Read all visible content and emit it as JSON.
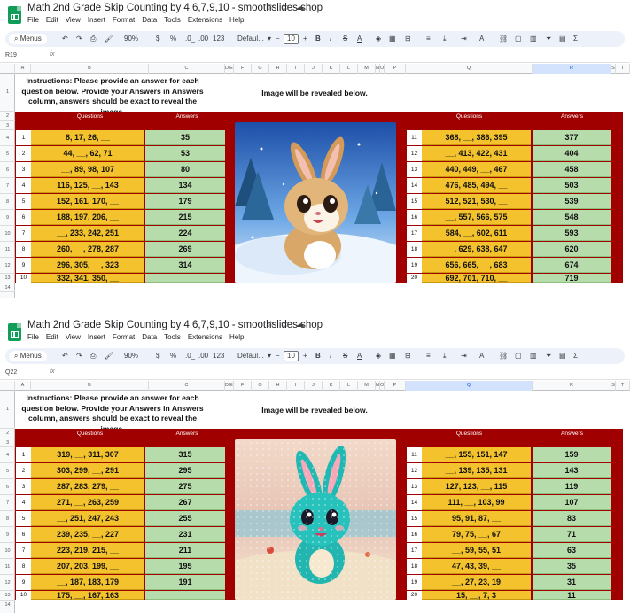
{
  "screenshots": [
    {
      "title": "Math 2nd Grade Skip Counting by 4,6,7,9,10 - smoothslides shop",
      "menu": [
        "File",
        "Edit",
        "View",
        "Insert",
        "Format",
        "Data",
        "Tools",
        "Extensions",
        "Help"
      ],
      "toolbar": {
        "menus": "Menus",
        "zoom": "90%",
        "currency": "$",
        "percent": "%",
        "dec_down": ".0_",
        "dec_up": ".00",
        "format_123": "123",
        "font": "Defaul...",
        "font_size": "10"
      },
      "cell_ref": "R19",
      "fx": "fx",
      "selected_col": "R",
      "instructions": "Instructions: Please provide an answer for each question below. Provide your Answers in Answers column, answers should be exact to reveal the image.",
      "reveal_text": "Image will be revealed below.",
      "header_questions": "Questions",
      "header_answers": "Answers",
      "image_description": "cartoon bunny in snowy winter scene",
      "left": [
        {
          "n": "1",
          "q": "8, 17, 26, __",
          "a": "35"
        },
        {
          "n": "2",
          "q": "44, __, 62, 71",
          "a": "53"
        },
        {
          "n": "3",
          "q": "__, 89, 98, 107",
          "a": "80"
        },
        {
          "n": "4",
          "q": "116, 125, __, 143",
          "a": "134"
        },
        {
          "n": "5",
          "q": "152, 161, 170, __",
          "a": "179"
        },
        {
          "n": "6",
          "q": "188, 197, 206, __",
          "a": "215"
        },
        {
          "n": "7",
          "q": "__, 233, 242, 251",
          "a": "224"
        },
        {
          "n": "8",
          "q": "260, __, 278, 287",
          "a": "269"
        },
        {
          "n": "9",
          "q": "296, 305, __, 323",
          "a": "314"
        },
        {
          "n": "10",
          "q": "332, 341, 350, __",
          "a": ""
        }
      ],
      "right": [
        {
          "n": "11",
          "q": "368, __, 386, 395",
          "a": "377"
        },
        {
          "n": "12",
          "q": "__, 413, 422, 431",
          "a": "404"
        },
        {
          "n": "13",
          "q": "440, 449, __, 467",
          "a": "458"
        },
        {
          "n": "14",
          "q": "476, 485, 494, __",
          "a": "503"
        },
        {
          "n": "15",
          "q": "512, 521, 530, __",
          "a": "539"
        },
        {
          "n": "16",
          "q": "__, 557, 566, 575",
          "a": "548"
        },
        {
          "n": "17",
          "q": "584, __, 602, 611",
          "a": "593"
        },
        {
          "n": "18",
          "q": "__, 629, 638, 647",
          "a": "620"
        },
        {
          "n": "19",
          "q": "656, 665, __, 683",
          "a": "674"
        },
        {
          "n": "20",
          "q": "692, 701, 710, __",
          "a": "719"
        }
      ]
    },
    {
      "title": "Math 2nd Grade Skip Counting by 4,6,7,9,10 - smoothslides shop",
      "menu": [
        "File",
        "Edit",
        "View",
        "Insert",
        "Format",
        "Data",
        "Tools",
        "Extensions",
        "Help"
      ],
      "toolbar": {
        "menus": "Menus",
        "zoom": "90%",
        "currency": "$",
        "percent": "%",
        "dec_down": ".0_",
        "dec_up": ".00",
        "format_123": "123",
        "font": "Defaul...",
        "font_size": "10"
      },
      "cell_ref": "Q22",
      "fx": "fx",
      "selected_col": "Q",
      "instructions": "Instructions: Please provide an answer for each question below. Provide your Answers in Answers column, answers should be exact to reveal the image.",
      "reveal_text": "Image will be revealed below.",
      "header_questions": "Questions",
      "header_answers": "Answers",
      "image_description": "teal cartoon bunny on beach, partially revealed",
      "left": [
        {
          "n": "1",
          "q": "319, __, 311, 307",
          "a": "315"
        },
        {
          "n": "2",
          "q": "303, 299, __, 291",
          "a": "295"
        },
        {
          "n": "3",
          "q": "287, 283, 279, __",
          "a": "275"
        },
        {
          "n": "4",
          "q": "271, __, 263, 259",
          "a": "267"
        },
        {
          "n": "5",
          "q": "__, 251, 247, 243",
          "a": "255"
        },
        {
          "n": "6",
          "q": "239, 235, __, 227",
          "a": "231"
        },
        {
          "n": "7",
          "q": "223, 219, 215, __",
          "a": "211"
        },
        {
          "n": "8",
          "q": "207, 203, 199, __",
          "a": "195"
        },
        {
          "n": "9",
          "q": "__, 187, 183, 179",
          "a": "191"
        },
        {
          "n": "10",
          "q": "175, __, 167, 163",
          "a": ""
        }
      ],
      "right": [
        {
          "n": "11",
          "q": "__, 155, 151, 147",
          "a": "159"
        },
        {
          "n": "12",
          "q": "__, 139, 135, 131",
          "a": "143"
        },
        {
          "n": "13",
          "q": "127, 123, __, 115",
          "a": "119"
        },
        {
          "n": "14",
          "q": "111, __, 103, 99",
          "a": "107"
        },
        {
          "n": "15",
          "q": "95, 91, 87, __",
          "a": "83"
        },
        {
          "n": "16",
          "q": "79, 75, __, 67",
          "a": "71"
        },
        {
          "n": "17",
          "q": "__, 59, 55, 51",
          "a": "63"
        },
        {
          "n": "18",
          "q": "47, 43, 39, __",
          "a": "35"
        },
        {
          "n": "19",
          "q": "__, 27, 23, 19",
          "a": "31"
        },
        {
          "n": "20",
          "q": "15, __, 7, 3",
          "a": "11"
        }
      ]
    }
  ],
  "colors": {
    "band": "#a00000",
    "question": "#f3c22d",
    "answer": "#b7dcab",
    "accent": "#0b57d0"
  },
  "col_letters": [
    "A",
    "B",
    "C",
    "D",
    "E",
    "F",
    "G",
    "H",
    "I",
    "J",
    "K",
    "L",
    "M",
    "N",
    "O",
    "P",
    "Q",
    "R",
    "S",
    "T"
  ],
  "row_labels": [
    "1",
    "2",
    "3",
    "4",
    "5",
    "6",
    "7",
    "8",
    "9",
    "10",
    "11",
    "12",
    "13",
    "14"
  ]
}
